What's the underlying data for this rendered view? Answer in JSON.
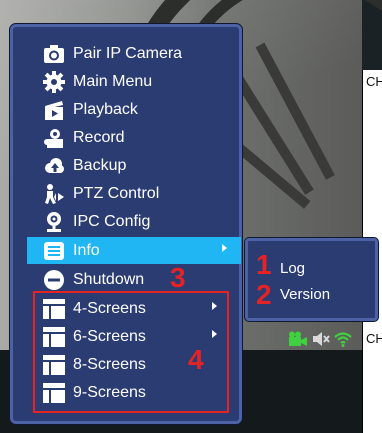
{
  "menu": {
    "items": [
      {
        "label": "Pair IP Camera",
        "icon": "camera-icon"
      },
      {
        "label": "Main Menu",
        "icon": "gear-icon"
      },
      {
        "label": "Playback",
        "icon": "playback-icon"
      },
      {
        "label": "Record",
        "icon": "record-icon"
      },
      {
        "label": "Backup",
        "icon": "cloud-upload-icon"
      },
      {
        "label": "PTZ Control",
        "icon": "ptz-icon"
      },
      {
        "label": "IPC Config",
        "icon": "ipc-config-icon"
      },
      {
        "label": "Info",
        "icon": "info-icon",
        "selected": true,
        "has_submenu": true
      },
      {
        "label": "Shutdown",
        "icon": "power-icon"
      },
      {
        "label": "4-Screens",
        "icon": "screens-icon",
        "has_submenu": true
      },
      {
        "label": "6-Screens",
        "icon": "screens-icon",
        "has_submenu": true
      },
      {
        "label": "8-Screens",
        "icon": "screens-icon"
      },
      {
        "label": "9-Screens",
        "icon": "screens-icon"
      }
    ]
  },
  "submenu": {
    "items": [
      {
        "label": "Log",
        "annotation": "1"
      },
      {
        "label": "Version",
        "annotation": "2"
      }
    ]
  },
  "annotations": {
    "shutdown": "3",
    "screens": "4",
    "color": "#e52324"
  },
  "channel_labels": [
    "CH",
    "CH"
  ],
  "colors": {
    "menu_bg": "#2b3c72",
    "menu_border": "#4d62a5",
    "selected": "#1fb6f3"
  }
}
